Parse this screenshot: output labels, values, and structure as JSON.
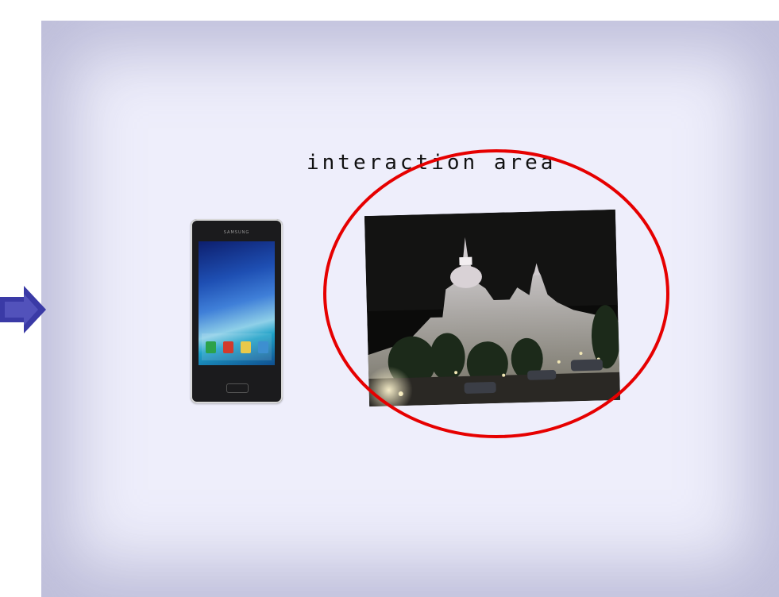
{
  "caption": "interaction area",
  "colors": {
    "highlight_ellipse": "#e60000",
    "arrow": "#3a3aa6",
    "frame_background": "#eeeefb"
  },
  "icons": {
    "arrow": "arrow-right-icon",
    "phone_apps": [
      "phone-app-icon",
      "contacts-app-icon",
      "messaging-app-icon",
      "apps-grid-icon"
    ]
  },
  "phone": {
    "brand": "SAMSUNG"
  }
}
